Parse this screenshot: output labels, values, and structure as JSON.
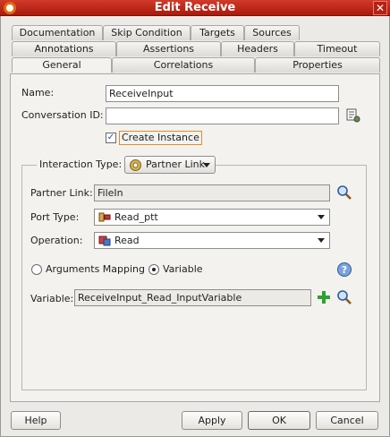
{
  "window": {
    "title": "Edit Receive",
    "close_symbol": "✕"
  },
  "tabs": {
    "row1": [
      "Documentation",
      "Skip Condition",
      "Targets",
      "Sources"
    ],
    "row2": [
      "Annotations",
      "Assertions",
      "Headers",
      "Timeout"
    ],
    "row3": [
      "General",
      "Correlations",
      "Properties"
    ],
    "active": "General"
  },
  "general": {
    "name_label": "Name:",
    "name_value": "ReceiveInput",
    "conversation_label": "Conversation ID:",
    "conversation_value": "",
    "create_instance_label": "Create Instance",
    "create_instance_checked": true,
    "interaction_type_label": "Interaction Type:",
    "interaction_type_value": "Partner Link",
    "partner_link_label": "Partner Link:",
    "partner_link_value": "FileIn",
    "port_type_label": "Port Type:",
    "port_type_value": "Read_ptt",
    "operation_label": "Operation:",
    "operation_value": "Read",
    "args_mapping_label": "Arguments Mapping",
    "variable_radio_label": "Variable",
    "variable_label": "Variable:",
    "variable_value": "ReceiveInput_Read_InputVariable"
  },
  "buttons": {
    "help": "Help",
    "apply": "Apply",
    "ok": "OK",
    "cancel": "Cancel"
  },
  "colors": {
    "title_bar": "#c0281a",
    "focus_outline": "#e38a2b",
    "add_icon": "#2fa12f",
    "help_icon": "#4a78c4"
  }
}
